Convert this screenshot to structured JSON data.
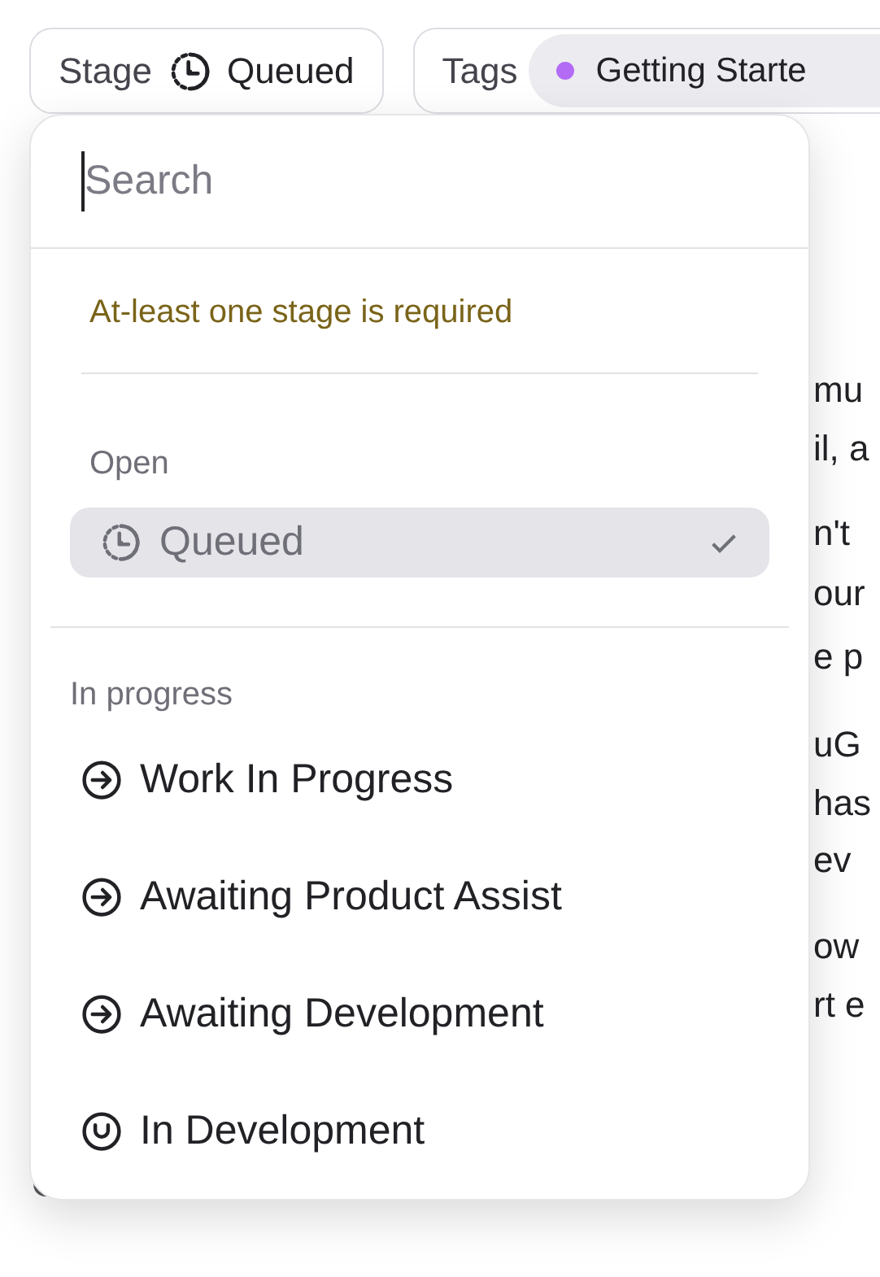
{
  "filters": [
    {
      "kind": "stage",
      "label": "Stage",
      "value": "Queued"
    },
    {
      "kind": "tags",
      "label": "Tags",
      "tags": [
        {
          "label": "Getting Starte",
          "color": "#b36bf5"
        }
      ]
    }
  ],
  "background_text": [
    "mu",
    "il, a",
    "n't",
    "our",
    "e p",
    "uG",
    "has",
    "ev",
    "ow",
    "rt e"
  ],
  "dropdown": {
    "search": {
      "placeholder": "Search"
    },
    "warning": "At-least one stage is required",
    "groups": [
      {
        "label": "Open",
        "items": [
          {
            "label": "Queued",
            "kind": "queued",
            "selected": true
          }
        ]
      },
      {
        "label": "In progress",
        "items": [
          {
            "label": "Work In Progress",
            "kind": "started",
            "selected": false
          },
          {
            "label": "Awaiting Product Assist",
            "kind": "started",
            "selected": false
          },
          {
            "label": "Awaiting Development",
            "kind": "started",
            "selected": false
          },
          {
            "label": "In Development",
            "kind": "development",
            "selected": false
          }
        ]
      }
    ]
  }
}
